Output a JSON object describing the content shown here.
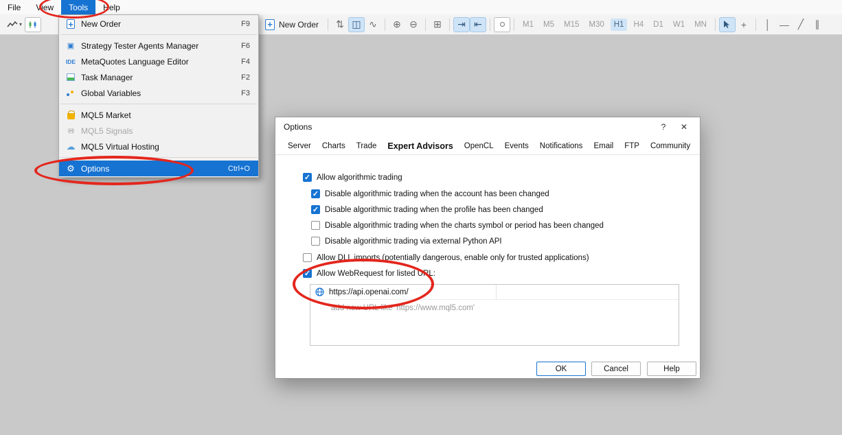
{
  "colors": {
    "accent": "#1673d2",
    "annotation_red": "#e3261d"
  },
  "icons": {
    "caret_down": "▾",
    "scale": "⇅",
    "bars": "◫",
    "wave": "∿",
    "zoom_in": "⊕",
    "zoom_out": "⊖",
    "grid": "⊞",
    "shift_end": "⇥",
    "auto_scroll": "⇤",
    "crosshair": "+",
    "vline": "│",
    "hline": "—",
    "trend": "╱",
    "channel": "∥",
    "gear": "⚙",
    "cloud": "☁",
    "signals": "((•))",
    "square": "▣"
  },
  "menubar": {
    "items": [
      {
        "label": "File"
      },
      {
        "label": "View"
      },
      {
        "label": "Tools",
        "active": true
      },
      {
        "label": "Help"
      }
    ]
  },
  "toolbar": {
    "new_order": "New Order",
    "timeframes": [
      {
        "label": "M1"
      },
      {
        "label": "M5"
      },
      {
        "label": "M15"
      },
      {
        "label": "M30"
      },
      {
        "label": "H1",
        "active": true
      },
      {
        "label": "H4"
      },
      {
        "label": "D1"
      },
      {
        "label": "W1"
      },
      {
        "label": "MN"
      }
    ]
  },
  "tools_menu": {
    "items": [
      {
        "label": "New Order",
        "shortcut": "F9"
      },
      {
        "label": "Strategy Tester Agents Manager",
        "shortcut": "F6"
      },
      {
        "label": "MetaQuotes Language Editor",
        "shortcut": "F4",
        "badge": "IDE"
      },
      {
        "label": "Task Manager",
        "shortcut": "F2"
      },
      {
        "label": "Global Variables",
        "shortcut": "F3"
      },
      {
        "label": "MQL5 Market"
      },
      {
        "label": "MQL5 Signals",
        "disabled": true
      },
      {
        "label": "MQL5 Virtual Hosting"
      },
      {
        "label": "Options",
        "shortcut": "Ctrl+O",
        "highlighted": true
      }
    ]
  },
  "dialog": {
    "title": "Options",
    "help_button": "?",
    "close_button": "✕",
    "tabs": [
      {
        "label": "Server"
      },
      {
        "label": "Charts"
      },
      {
        "label": "Trade"
      },
      {
        "label": "Expert Advisors",
        "active": true
      },
      {
        "label": "OpenCL"
      },
      {
        "label": "Events"
      },
      {
        "label": "Notifications"
      },
      {
        "label": "Email"
      },
      {
        "label": "FTP"
      },
      {
        "label": "Community"
      }
    ],
    "checkboxes": [
      {
        "label": "Allow algorithmic trading",
        "checked": true
      },
      {
        "label": "Disable algorithmic trading when the account has been changed",
        "checked": true
      },
      {
        "label": "Disable algorithmic trading when the profile has been changed",
        "checked": true
      },
      {
        "label": "Disable algorithmic trading when the charts symbol or period has been changed",
        "checked": false
      },
      {
        "label": "Disable algorithmic trading via external Python API",
        "checked": false
      },
      {
        "label": "Allow DLL imports (potentially dangerous, enable only for trusted applications)",
        "checked": false
      },
      {
        "label": "Allow WebRequest for listed URL:",
        "checked": true
      }
    ],
    "url_list": {
      "entries": [
        {
          "url": "https://api.openai.com/"
        }
      ],
      "hint": "add new URL like 'https://www.mql5.com'"
    },
    "buttons": {
      "ok": "OK",
      "cancel": "Cancel",
      "help": "Help"
    }
  }
}
